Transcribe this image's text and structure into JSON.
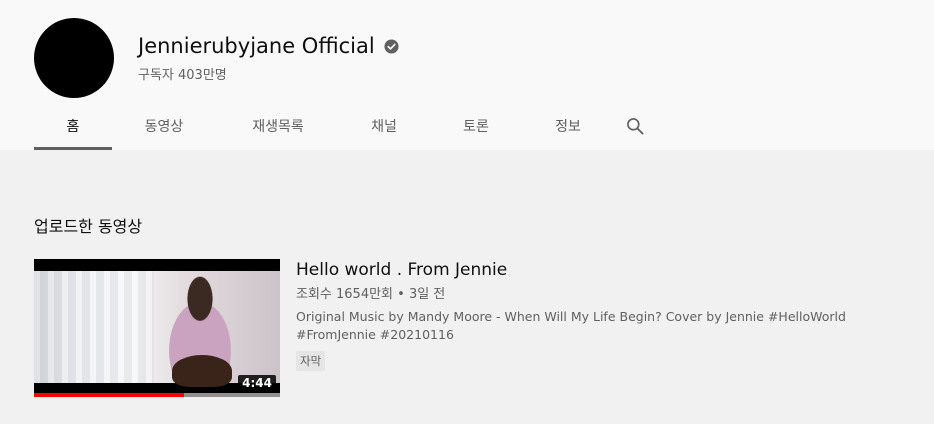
{
  "channel": {
    "name": "Jennierubyjane Official",
    "subscribers": "구독자 403만명",
    "verified_icon": "verified-check-icon"
  },
  "tabs": [
    {
      "label": "홈",
      "active": true
    },
    {
      "label": "동영상",
      "active": false
    },
    {
      "label": "재생목록",
      "active": false
    },
    {
      "label": "채널",
      "active": false
    },
    {
      "label": "토론",
      "active": false
    },
    {
      "label": "정보",
      "active": false
    }
  ],
  "search_icon": "search-icon",
  "section": {
    "title": "업로드한 동영상"
  },
  "video": {
    "title": "Hello world . From Jennie",
    "meta": "조회수 1654만회 • 3일 전",
    "description": "Original Music by Mandy Moore - When Will My Life Begin? Cover by Jennie #HelloWorld #FromJennie #20210116",
    "badge": "자막",
    "duration": "4:44",
    "watch_progress": 0.61
  },
  "colors": {
    "accent": "#ff0000",
    "tab_underline": "#606060",
    "header_bg": "#f9f9f9",
    "page_bg": "#f1f1f1"
  }
}
